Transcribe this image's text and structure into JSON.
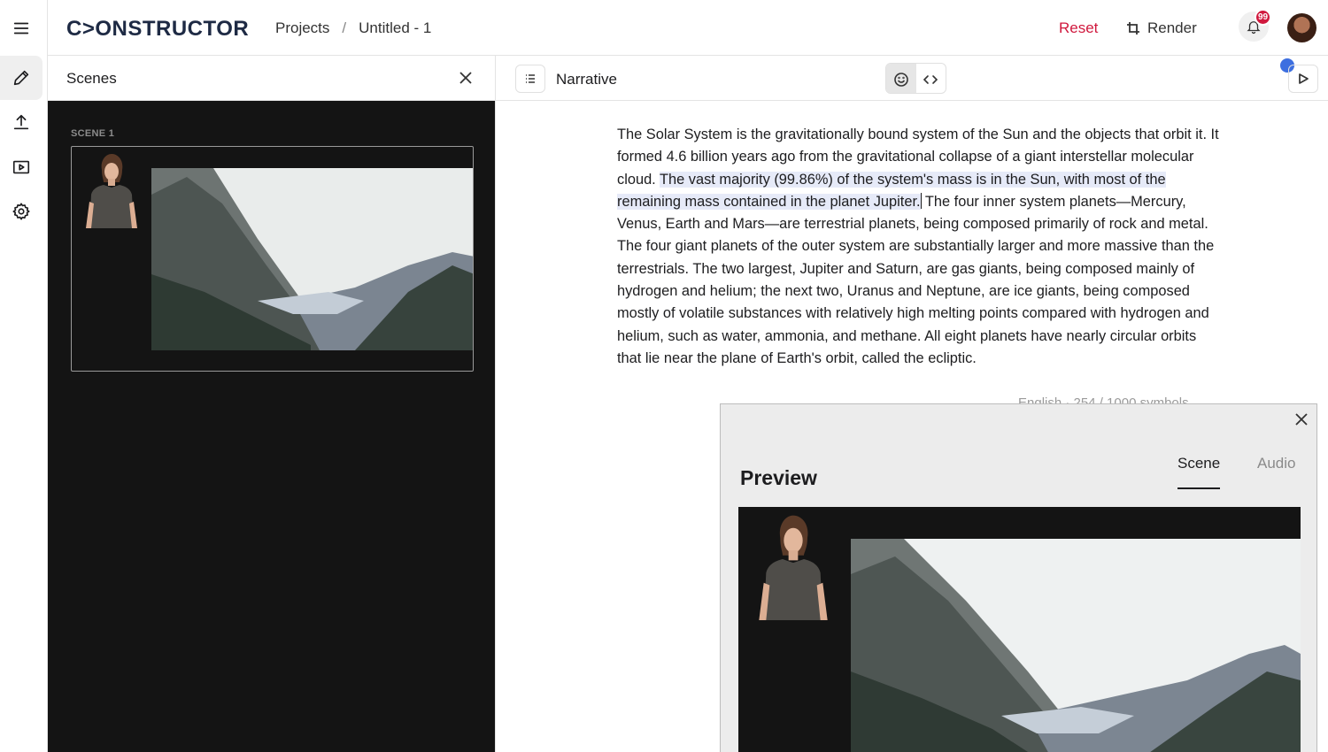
{
  "app": {
    "logo": "C>ONSTRUCTOR",
    "breadcrumb": [
      "Projects",
      "Untitled - 1"
    ],
    "breadcrumb_sep": "/",
    "reset_label": "Reset",
    "render_label": "Render",
    "notification_count": "99"
  },
  "rail": {
    "items": [
      "menu-icon",
      "edit-icon",
      "upload-icon",
      "media-icon",
      "settings-icon"
    ],
    "active": "edit-icon"
  },
  "scenes": {
    "title": "Scenes",
    "items": [
      {
        "label": "SCENE 1"
      }
    ]
  },
  "narrative": {
    "title": "Narrative",
    "text_before": "The Solar System is the gravitationally bound system of the Sun and the objects that orbit it.  It formed 4.6 billion years ago from the gravitational collapse of a giant interstellar molecular cloud. ",
    "text_highlight": "The vast majority (99.86%) of the system's mass is in the Sun, with most of the remaining mass contained in the planet Jupiter.",
    "text_after": " The four inner system planets—Mercury, Venus, Earth and Mars—are terrestrial planets, being composed primarily of rock and metal. The four giant planets of the outer system are substantially larger and more massive than the terrestrials. The two largest, Jupiter and Saturn, are gas giants, being composed mainly of hydrogen and helium; the next two, Uranus and Neptune, are ice giants, being composed mostly of volatile substances with relatively high melting points compared with hydrogen and helium, such as water, ammonia, and methane. All eight planets have nearly circular orbits that lie near the plane of Earth's orbit, called the ecliptic.",
    "meta": "English · 254 / 1000 symbols"
  },
  "preview": {
    "title": "Preview",
    "tabs": [
      "Scene",
      "Audio"
    ],
    "active_tab": "Scene"
  },
  "colors": {
    "accent": "#d0183d",
    "highlight": "#e6eaf8",
    "dark_panel": "#141414",
    "blue_dot": "#3d6fe0"
  }
}
